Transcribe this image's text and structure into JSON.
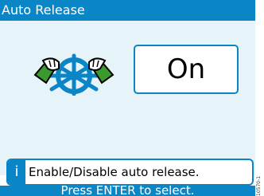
{
  "screen": {
    "title": "Auto Release",
    "value": "On",
    "info_icon": "i",
    "info_text": "Enable/Disable auto release.",
    "footer": "Press ENTER to select.",
    "ref_code": "10570-1"
  },
  "icons": {
    "setting_icon": "ship-wheel-with-hands-icon",
    "info_icon": "info-icon"
  },
  "colors": {
    "accent": "#0a85c6",
    "panel_bg": "#e6f3f8",
    "hand_green": "#3a9a2e"
  }
}
